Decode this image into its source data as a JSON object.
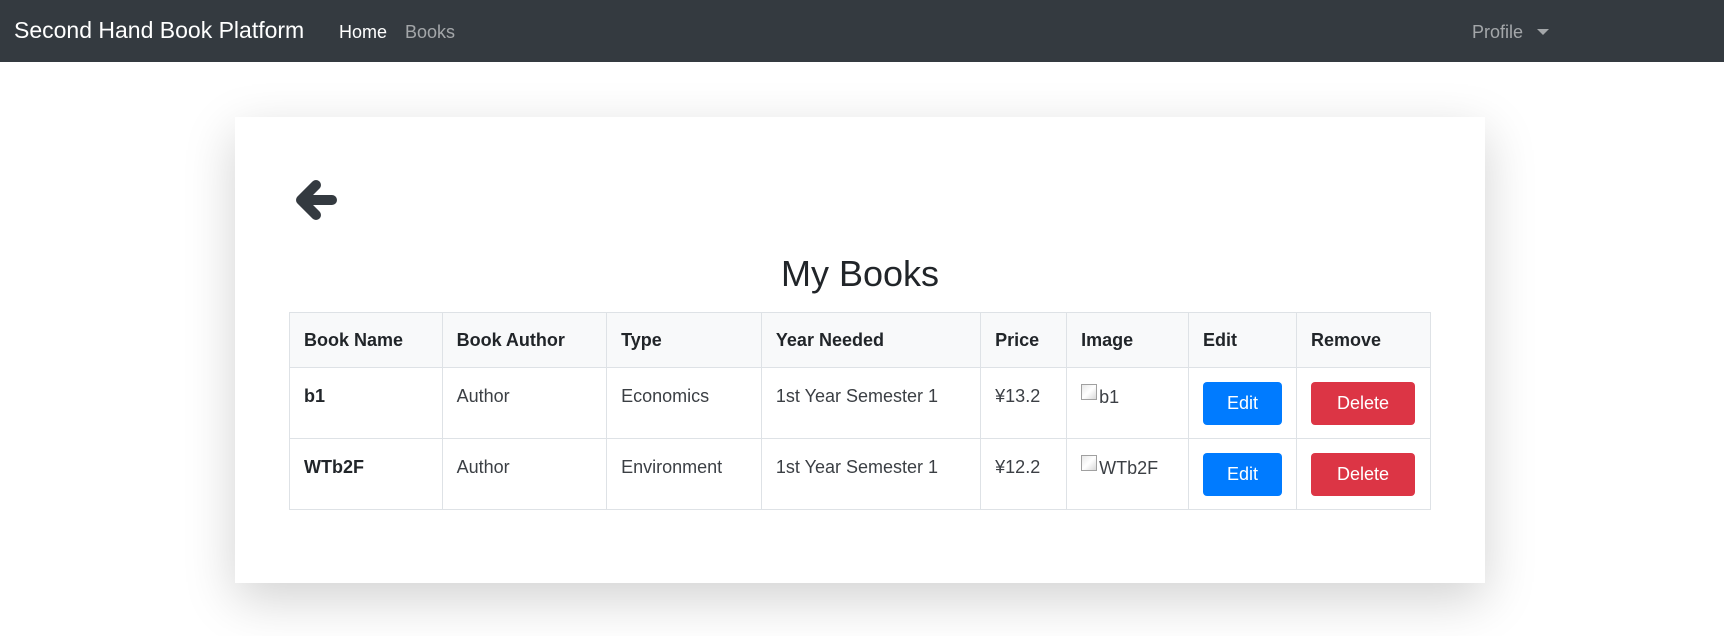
{
  "navbar": {
    "brand": "Second Hand Book Platform",
    "links": [
      {
        "label": "Home",
        "active": true
      },
      {
        "label": "Books",
        "active": false
      }
    ],
    "profile_label": "Profile"
  },
  "page": {
    "back_icon": "arrow-left-icon",
    "title": "My Books"
  },
  "table": {
    "headers": [
      "Book Name",
      "Book Author",
      "Type",
      "Year Needed",
      "Price",
      "Image",
      "Edit",
      "Remove"
    ],
    "rows": [
      {
        "name": "b1",
        "author": "Author",
        "type": "Economics",
        "year": "1st Year Semester 1",
        "price": "¥13.2",
        "image_alt": "b1",
        "edit_label": "Edit",
        "delete_label": "Delete"
      },
      {
        "name": "WTb2F",
        "author": "Author",
        "type": "Environment",
        "year": "1st Year Semester 1",
        "price": "¥12.2",
        "image_alt": "WTb2F",
        "edit_label": "Edit",
        "delete_label": "Delete"
      }
    ]
  },
  "colors": {
    "navbar_bg": "#343a40",
    "edit_button": "#007bff",
    "delete_button": "#dc3545"
  }
}
